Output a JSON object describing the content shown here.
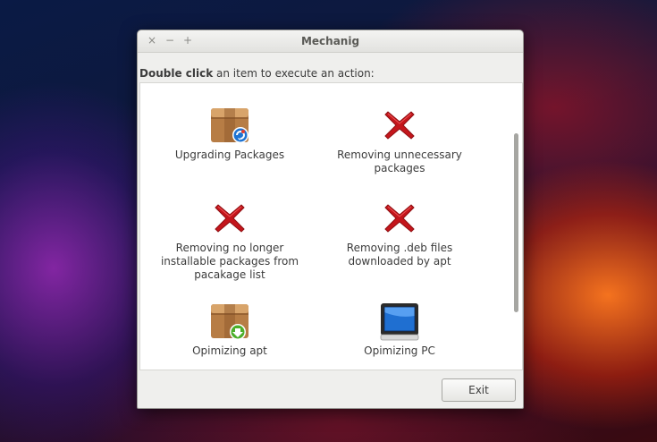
{
  "window": {
    "title": "Mechanig",
    "controls": {
      "close": "×",
      "minimize": "−",
      "maximize": "+"
    }
  },
  "prompt": {
    "bold": "Double click",
    "rest": " an item to execute an action:"
  },
  "items": [
    {
      "label": "Upgrading Packages",
      "icon": "package-upgrade-icon"
    },
    {
      "label": "Removing unnecessary packages",
      "icon": "red-x-icon"
    },
    {
      "label": "Removing no longer installable packages from pacakage list",
      "icon": "red-x-icon"
    },
    {
      "label": "Removing .deb files downloaded by apt",
      "icon": "red-x-icon"
    },
    {
      "label": "Opimizing apt",
      "icon": "package-download-icon"
    },
    {
      "label": "Opimizing PC",
      "icon": "monitor-icon"
    }
  ],
  "buttons": {
    "exit": "Exit"
  },
  "colors": {
    "x_red": "#c4161c",
    "accent_blue": "#1e73d2",
    "box_brown": "#b77d45"
  }
}
